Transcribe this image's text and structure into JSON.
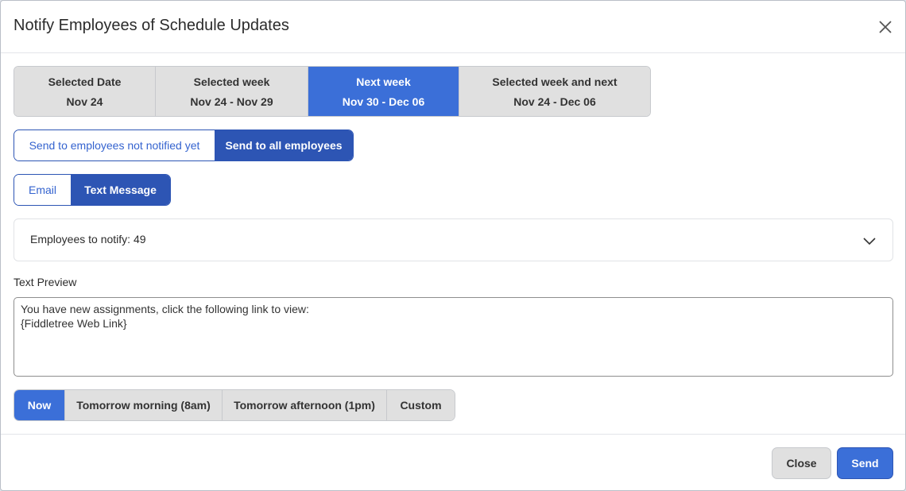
{
  "modal": {
    "title": "Notify Employees of Schedule Updates",
    "close_icon": "close-icon"
  },
  "week_options": [
    {
      "label": "Selected Date",
      "range": "Nov 24",
      "active": false
    },
    {
      "label": "Selected week",
      "range": "Nov 24 - Nov 29",
      "active": false
    },
    {
      "label": "Next week",
      "range": "Nov 30 - Dec 06",
      "active": true
    },
    {
      "label": "Selected week and next",
      "range": "Nov 24 - Dec 06",
      "active": false
    }
  ],
  "recipients": {
    "not_notified_label": "Send to employees not notified yet",
    "all_label": "Send to all employees",
    "selected": "all"
  },
  "channel": {
    "email_label": "Email",
    "text_label": "Text Message",
    "selected": "text"
  },
  "employees": {
    "label": "Employees to notify: 49",
    "chevron_icon": "chevron-down-icon"
  },
  "preview": {
    "label": "Text Preview",
    "text": "You have new assignments, click the following link to view:\n{Fiddletree Web Link}"
  },
  "timing": [
    {
      "label": "Now",
      "active": true
    },
    {
      "label": "Tomorrow morning (8am)",
      "active": false
    },
    {
      "label": "Tomorrow afternoon (1pm)",
      "active": false
    },
    {
      "label": "Custom",
      "active": false
    }
  ],
  "footer": {
    "close_label": "Close",
    "send_label": "Send"
  },
  "colors": {
    "accent": "#3b6fd8",
    "accent_dark": "#2d55b4",
    "inactive_bg": "#e0e0e0"
  }
}
